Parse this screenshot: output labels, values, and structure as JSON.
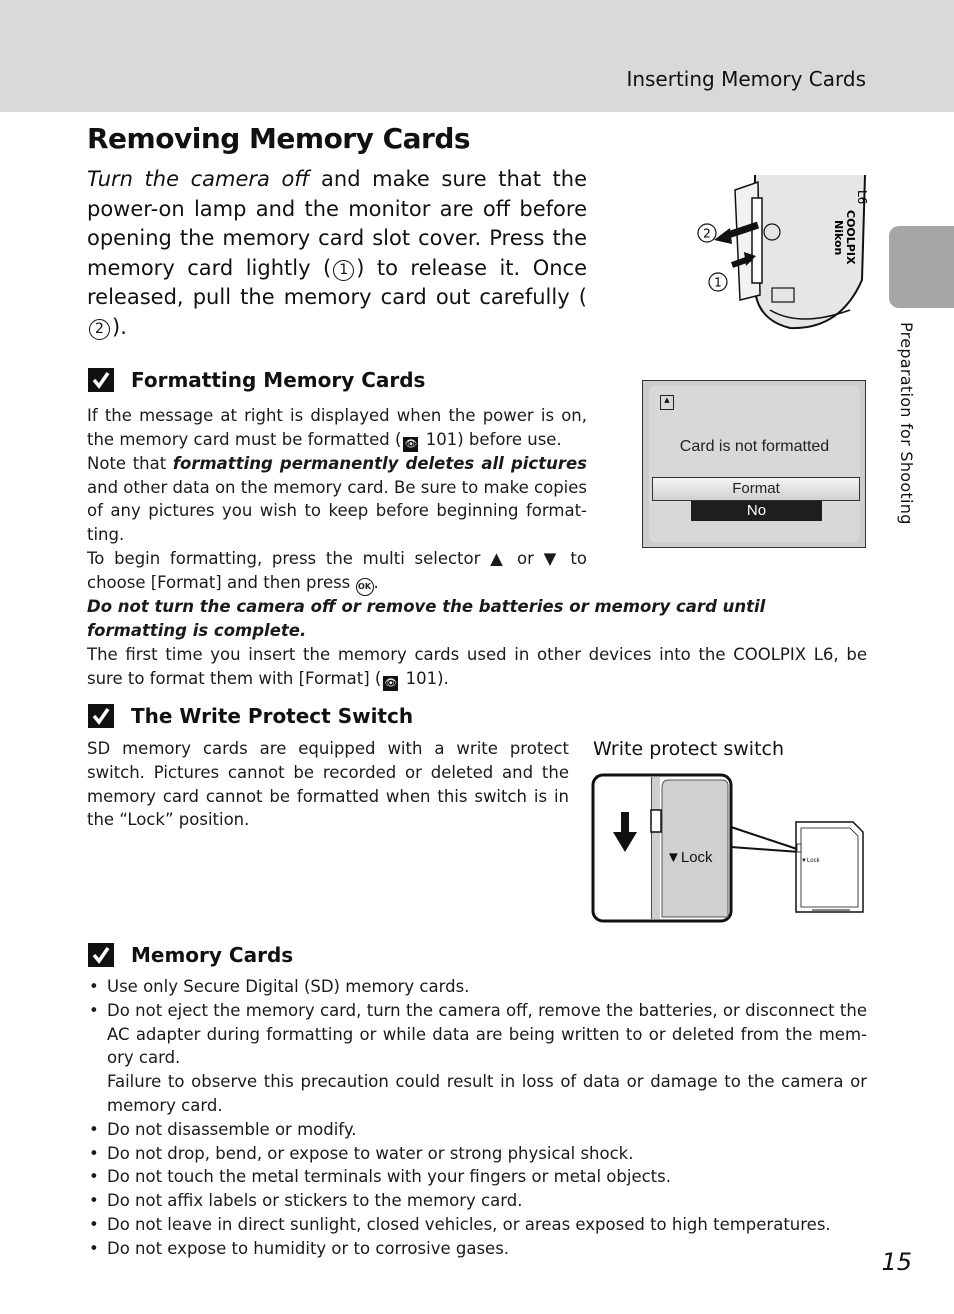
{
  "header": {
    "running_head": "Inserting Memory Cards"
  },
  "page_title": "Removing Memory Cards",
  "intro": {
    "emphasis": "Turn the camera off",
    "text_1": " and make sure that the power-on lamp and the monitor are off before opening the memory card slot cover. Press the memory card lightly (",
    "step_1": "1",
    "text_2": ") to release it. Once released, pull the memory card out carefully (",
    "step_2": "2",
    "text_3": ")."
  },
  "camera_figure": {
    "callout_1": "1",
    "callout_2": "2",
    "icon": "camera-card-slot-illustration"
  },
  "side_tab": {
    "label": "Preparation for Shooting"
  },
  "formatting_note": {
    "heading": "Formatting Memory Cards",
    "icon": "check-note-icon",
    "p1_a": "If the message at right is displayed when the power is on, the memory card must be formatted (",
    "p1_ref": "101",
    "p1_b": ") before use.",
    "p2_a": "Note that ",
    "p2_em": "formatting permanently deletes all pictures",
    "p2_b": " and other data on the memory card. Be sure to make copies of any pictures you wish to keep before beginning format-ting.",
    "p3_a": "To begin formatting, press the multi selector ",
    "p3_up": "▲",
    "p3_or": " or ",
    "p3_down": "▼",
    "p3_b": " to choose [Format] and then press ",
    "p3_ok": "OK",
    "p3_c": ".",
    "warning": "Do not turn the camera off or remove the batteries or memory card until formatting is complete.",
    "p4_a": "The first time you insert the memory cards used in other devices into the COOLPIX L6, be sure to format them with [Format] (",
    "p4_ref": "101",
    "p4_b": ")."
  },
  "lcd_screen": {
    "message": "Card is not formatted",
    "options": [
      "Format",
      "No"
    ],
    "selected": "No",
    "card_icon": "▲"
  },
  "write_protect_note": {
    "heading": "The Write Protect Switch",
    "icon": "check-note-icon",
    "text": "SD memory cards are equipped with a write protect switch. Pictures cannot be recorded or deleted and the memory card cannot be formatted when this switch is in the “Lock” position.",
    "figure_caption": "Write protect switch",
    "lock_label": "▼Lock",
    "small_lock_label": "▼Lock"
  },
  "memory_cards_note": {
    "heading": "Memory Cards",
    "icon": "check-note-icon",
    "bullets": [
      "Use only Secure Digital (SD) memory cards.",
      "Do not eject the memory card, turn the camera off, remove the batteries, or disconnect the AC adapter during formatting or while data are being written to or deleted from the mem-ory card.",
      "Do not disassemble or modify.",
      "Do not drop, bend, or expose to water or strong physical shock.",
      "Do not touch the metal terminals with your fingers or metal objects.",
      "Do not affix labels or stickers to the memory card.",
      "Do not leave in direct sunlight, closed vehicles, or areas exposed to high temperatures.",
      "Do not expose to humidity or to corrosive gases."
    ],
    "bullet_2_followup": "Failure to observe this precaution could result in loss of data or damage to the camera or memory card."
  },
  "page_number": "15"
}
